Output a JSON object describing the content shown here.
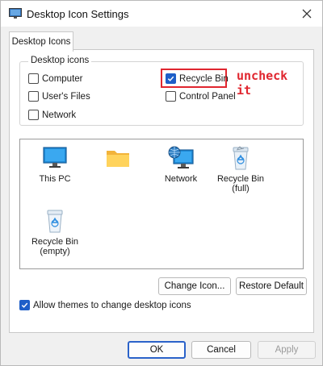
{
  "window": {
    "title": "Desktop Icon Settings"
  },
  "tabs": [
    {
      "label": "Desktop Icons"
    }
  ],
  "group": {
    "legend": "Desktop icons",
    "items": [
      {
        "label": "Computer",
        "checked": false
      },
      {
        "label": "User's Files",
        "checked": false
      },
      {
        "label": "Network",
        "checked": false
      },
      {
        "label": "Recycle Bin",
        "checked": true
      },
      {
        "label": "Control Panel",
        "checked": false
      }
    ]
  },
  "annotation": {
    "text": "uncheck it",
    "color": "#e0262f"
  },
  "icons": [
    {
      "label": "This PC",
      "icon": "monitor-icon"
    },
    {
      "label": "",
      "icon": "folder-icon"
    },
    {
      "label": "Network",
      "icon": "network-globe-icon"
    },
    {
      "label": "Recycle Bin\n(full)",
      "icon": "recycle-bin-full-icon"
    },
    {
      "label": "Recycle Bin\n(empty)",
      "icon": "recycle-bin-empty-icon"
    }
  ],
  "buttons": {
    "change_icon": "Change Icon...",
    "restore_default": "Restore Default",
    "ok": "OK",
    "cancel": "Cancel",
    "apply": "Apply"
  },
  "allow_themes": {
    "label": "Allow themes to change desktop icons",
    "checked": true
  },
  "colors": {
    "accent": "#1e5ec8",
    "annotation": "#e0262f",
    "dialog_bg": "#f0f0f0"
  }
}
